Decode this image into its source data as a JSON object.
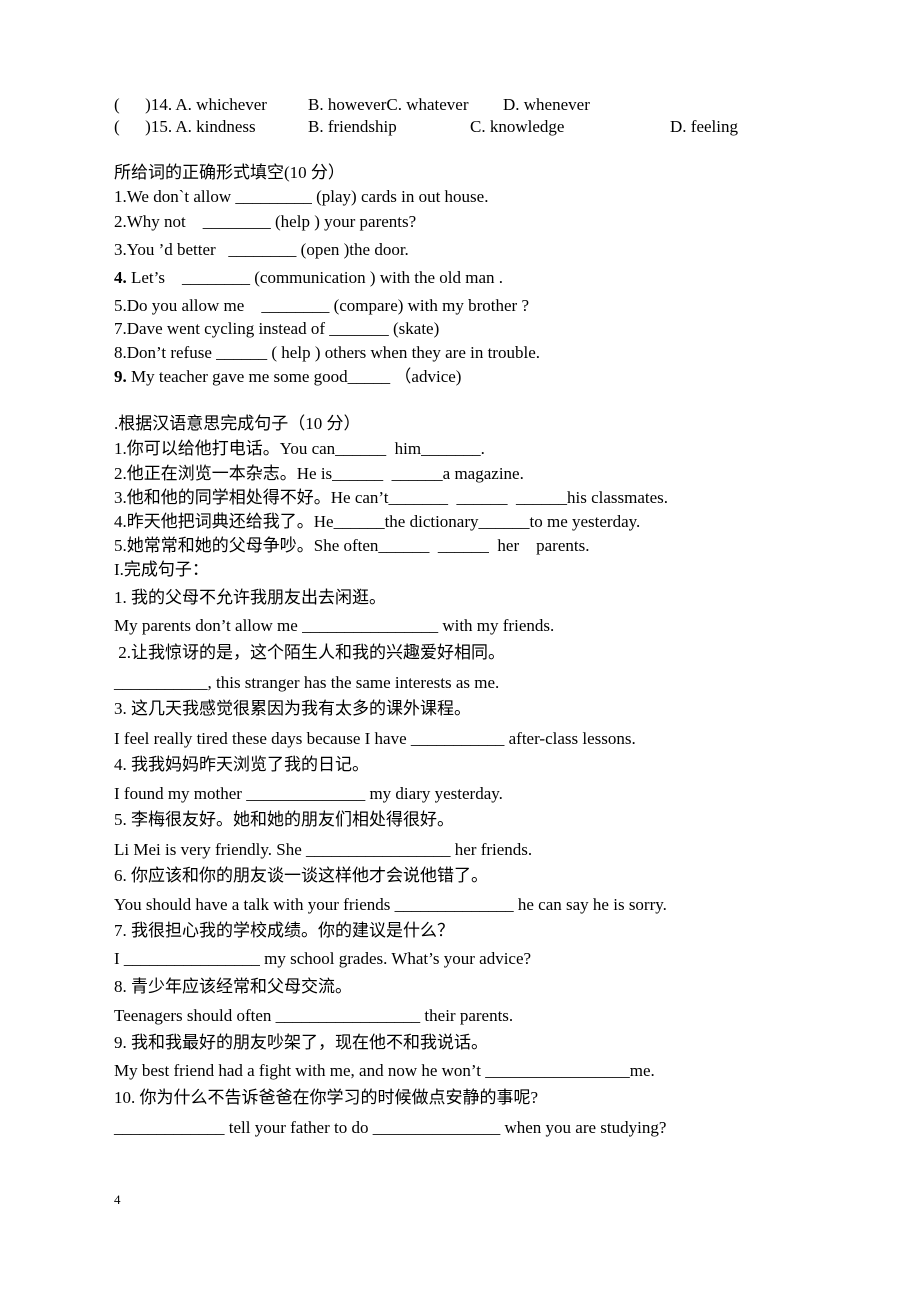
{
  "choices": [
    {
      "num": "(      )14. A. whichever",
      "b": "B. howeverC. whatever",
      "c": "",
      "d": "D. whenever"
    },
    {
      "num": "(      )15. A. kindness",
      "b": "B. friendship",
      "c": "C. knowledge",
      "d": "D. feeling"
    }
  ],
  "section1": {
    "title": "所给词的正确形式填空(10 分）",
    "items": [
      {
        "bold": "",
        "text": "1.We don`t allow _________ (play) cards in out house."
      },
      {
        "bold": "",
        "text": "2.Why not    ________ (help ) your parents?"
      },
      {
        "bold": "",
        "text": "3.You ’d better   ________ (open )the door."
      },
      {
        "bold": "4.",
        "text": " Let’s    ________ (communication ) with the old man ."
      },
      {
        "bold": "",
        "text": "5.Do you allow me    ________ (compare) with my brother ?"
      },
      {
        "bold": "",
        "text": "7.Dave went cycling instead of _______ (skate)"
      },
      {
        "bold": "",
        "text": "8.Don’t refuse ______ ( help ) others when they are in trouble."
      },
      {
        "bold": "9.",
        "text": " My teacher gave me some good_____ （advice)"
      }
    ]
  },
  "section2": {
    "title": ".根据汉语意思完成句子（10 分）",
    "items": [
      "1.你可以给他打电话。You can______  him_______.",
      "2.他正在浏览一本杂志。He is______  ______a magazine.",
      "3.他和他的同学相处得不好。He can’t_______  ______  ______his classmates.",
      "4.昨天他把词典还给我了。He______the dictionary______to me yesterday.",
      "5.她常常和她的父母争吵。She often______  ______  her    parents."
    ]
  },
  "section3": {
    "title": "I.完成句子：",
    "items": [
      {
        "cn": "1. 我的父母不允许我朋友出去闲逛。",
        "en": "My parents don’t allow me ________________ with my friends."
      },
      {
        "cn": " 2.让我惊讶的是，这个陌生人和我的兴趣爱好相同。",
        "en": "___________, this stranger has the same interests as me."
      },
      {
        "cn": "3. 这几天我感觉很累因为我有太多的课外课程。",
        "en": "I feel really tired these days because I have ___________ after-class lessons."
      },
      {
        "cn": "4. 我我妈妈昨天浏览了我的日记。",
        "en": "I found my mother ______________ my diary yesterday."
      },
      {
        "cn": "5. 李梅很友好。她和她的朋友们相处得很好。",
        "en": "Li Mei is very friendly. She _________________ her friends."
      },
      {
        "cn": "6. 你应该和你的朋友谈一谈这样他才会说他错了。",
        "en": "You should have a talk with your friends ______________ he can say he is sorry."
      },
      {
        "cn": "7. 我很担心我的学校成绩。你的建议是什么？",
        "en": "I ________________ my school grades. What’s your advice?"
      },
      {
        "cn": "8. 青少年应该经常和父母交流。",
        "en": "Teenagers should often _________________ their parents."
      },
      {
        "cn": "9. 我和我最好的朋友吵架了，现在他不和我说话。",
        "en": "My best friend had a fight with me, and now he won’t _________________me."
      },
      {
        "cn": "10. 你为什么不告诉爸爸在你学习的时候做点安静的事呢?",
        "en": "_____________ tell your father to do _______________ when you are studying?"
      }
    ]
  },
  "page_number": "4"
}
